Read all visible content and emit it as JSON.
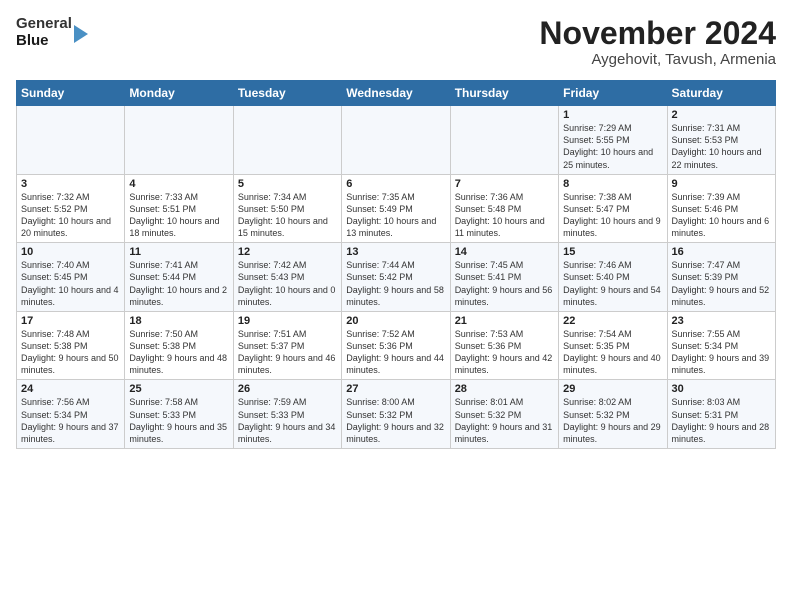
{
  "header": {
    "logo_line1": "General",
    "logo_line2": "Blue",
    "title": "November 2024",
    "subtitle": "Aygehovit, Tavush, Armenia"
  },
  "weekdays": [
    "Sunday",
    "Monday",
    "Tuesday",
    "Wednesday",
    "Thursday",
    "Friday",
    "Saturday"
  ],
  "weeks": [
    [
      {
        "day": "",
        "info": ""
      },
      {
        "day": "",
        "info": ""
      },
      {
        "day": "",
        "info": ""
      },
      {
        "day": "",
        "info": ""
      },
      {
        "day": "",
        "info": ""
      },
      {
        "day": "1",
        "info": "Sunrise: 7:29 AM\nSunset: 5:55 PM\nDaylight: 10 hours and 25 minutes."
      },
      {
        "day": "2",
        "info": "Sunrise: 7:31 AM\nSunset: 5:53 PM\nDaylight: 10 hours and 22 minutes."
      }
    ],
    [
      {
        "day": "3",
        "info": "Sunrise: 7:32 AM\nSunset: 5:52 PM\nDaylight: 10 hours and 20 minutes."
      },
      {
        "day": "4",
        "info": "Sunrise: 7:33 AM\nSunset: 5:51 PM\nDaylight: 10 hours and 18 minutes."
      },
      {
        "day": "5",
        "info": "Sunrise: 7:34 AM\nSunset: 5:50 PM\nDaylight: 10 hours and 15 minutes."
      },
      {
        "day": "6",
        "info": "Sunrise: 7:35 AM\nSunset: 5:49 PM\nDaylight: 10 hours and 13 minutes."
      },
      {
        "day": "7",
        "info": "Sunrise: 7:36 AM\nSunset: 5:48 PM\nDaylight: 10 hours and 11 minutes."
      },
      {
        "day": "8",
        "info": "Sunrise: 7:38 AM\nSunset: 5:47 PM\nDaylight: 10 hours and 9 minutes."
      },
      {
        "day": "9",
        "info": "Sunrise: 7:39 AM\nSunset: 5:46 PM\nDaylight: 10 hours and 6 minutes."
      }
    ],
    [
      {
        "day": "10",
        "info": "Sunrise: 7:40 AM\nSunset: 5:45 PM\nDaylight: 10 hours and 4 minutes."
      },
      {
        "day": "11",
        "info": "Sunrise: 7:41 AM\nSunset: 5:44 PM\nDaylight: 10 hours and 2 minutes."
      },
      {
        "day": "12",
        "info": "Sunrise: 7:42 AM\nSunset: 5:43 PM\nDaylight: 10 hours and 0 minutes."
      },
      {
        "day": "13",
        "info": "Sunrise: 7:44 AM\nSunset: 5:42 PM\nDaylight: 9 hours and 58 minutes."
      },
      {
        "day": "14",
        "info": "Sunrise: 7:45 AM\nSunset: 5:41 PM\nDaylight: 9 hours and 56 minutes."
      },
      {
        "day": "15",
        "info": "Sunrise: 7:46 AM\nSunset: 5:40 PM\nDaylight: 9 hours and 54 minutes."
      },
      {
        "day": "16",
        "info": "Sunrise: 7:47 AM\nSunset: 5:39 PM\nDaylight: 9 hours and 52 minutes."
      }
    ],
    [
      {
        "day": "17",
        "info": "Sunrise: 7:48 AM\nSunset: 5:38 PM\nDaylight: 9 hours and 50 minutes."
      },
      {
        "day": "18",
        "info": "Sunrise: 7:50 AM\nSunset: 5:38 PM\nDaylight: 9 hours and 48 minutes."
      },
      {
        "day": "19",
        "info": "Sunrise: 7:51 AM\nSunset: 5:37 PM\nDaylight: 9 hours and 46 minutes."
      },
      {
        "day": "20",
        "info": "Sunrise: 7:52 AM\nSunset: 5:36 PM\nDaylight: 9 hours and 44 minutes."
      },
      {
        "day": "21",
        "info": "Sunrise: 7:53 AM\nSunset: 5:36 PM\nDaylight: 9 hours and 42 minutes."
      },
      {
        "day": "22",
        "info": "Sunrise: 7:54 AM\nSunset: 5:35 PM\nDaylight: 9 hours and 40 minutes."
      },
      {
        "day": "23",
        "info": "Sunrise: 7:55 AM\nSunset: 5:34 PM\nDaylight: 9 hours and 39 minutes."
      }
    ],
    [
      {
        "day": "24",
        "info": "Sunrise: 7:56 AM\nSunset: 5:34 PM\nDaylight: 9 hours and 37 minutes."
      },
      {
        "day": "25",
        "info": "Sunrise: 7:58 AM\nSunset: 5:33 PM\nDaylight: 9 hours and 35 minutes."
      },
      {
        "day": "26",
        "info": "Sunrise: 7:59 AM\nSunset: 5:33 PM\nDaylight: 9 hours and 34 minutes."
      },
      {
        "day": "27",
        "info": "Sunrise: 8:00 AM\nSunset: 5:32 PM\nDaylight: 9 hours and 32 minutes."
      },
      {
        "day": "28",
        "info": "Sunrise: 8:01 AM\nSunset: 5:32 PM\nDaylight: 9 hours and 31 minutes."
      },
      {
        "day": "29",
        "info": "Sunrise: 8:02 AM\nSunset: 5:32 PM\nDaylight: 9 hours and 29 minutes."
      },
      {
        "day": "30",
        "info": "Sunrise: 8:03 AM\nSunset: 5:31 PM\nDaylight: 9 hours and 28 minutes."
      }
    ]
  ]
}
